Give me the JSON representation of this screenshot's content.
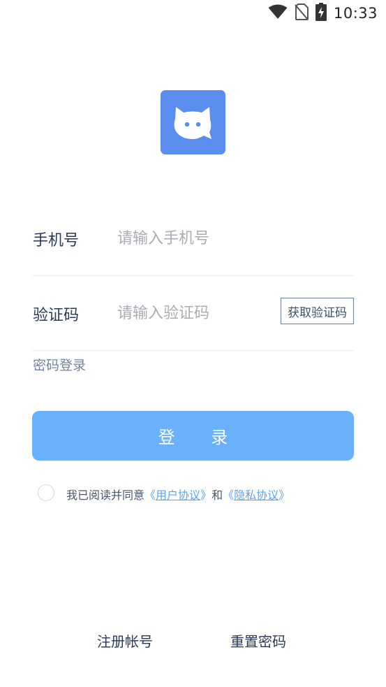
{
  "status_bar": {
    "time": "10:33"
  },
  "form": {
    "phone_label": "手机号",
    "phone_placeholder": "请输入手机号",
    "code_label": "验证码",
    "code_placeholder": "请输入验证码",
    "get_code_label": "获取验证码",
    "password_login": "密码登录",
    "login_button": "登 录"
  },
  "agreement": {
    "prefix": "我已阅读并同意",
    "user_agreement": "用户协议",
    "conjunction": "和",
    "privacy_policy": "隐私协议"
  },
  "footer": {
    "register": "注册帐号",
    "reset_password": "重置密码"
  },
  "colors": {
    "logo_bg": "#5b8cf0",
    "login_button": "#6ab1fb",
    "link": "#5aa3f0"
  },
  "icons": {
    "logo": "cat-chat-icon",
    "wifi": "wifi-icon",
    "sim": "no-sim-icon",
    "battery": "battery-charging-icon"
  }
}
